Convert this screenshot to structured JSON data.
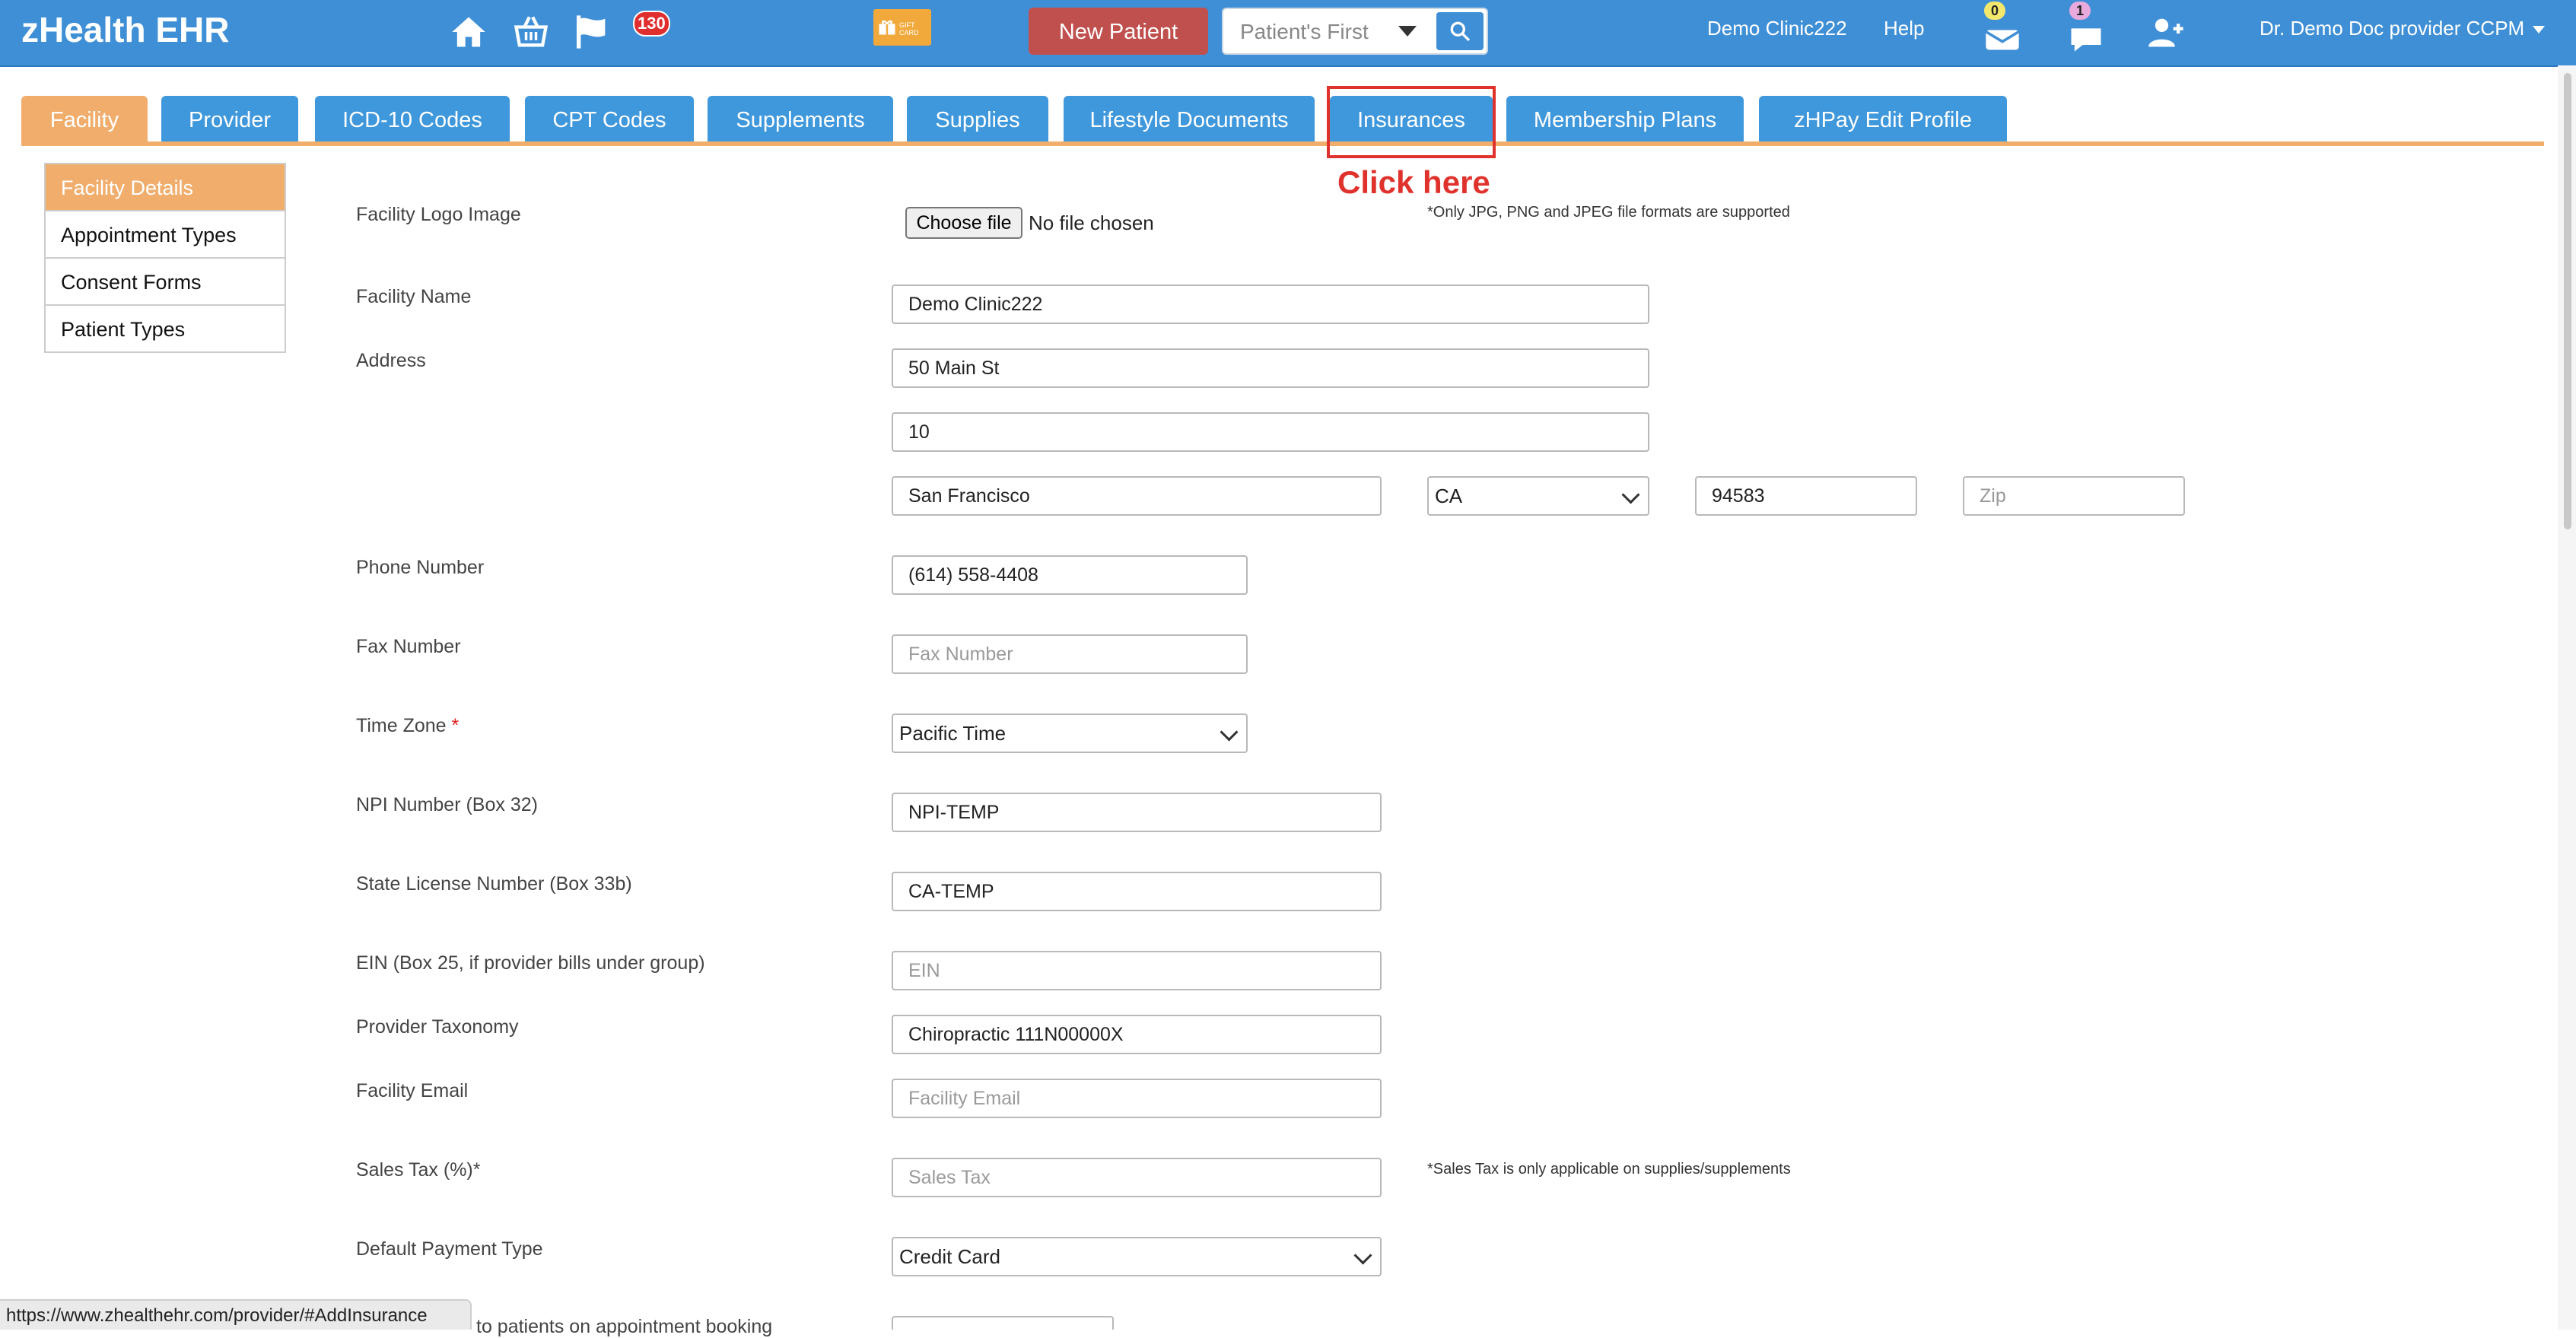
{
  "header": {
    "brand": "zHealth EHR",
    "icons": [
      "home-icon",
      "basket-icon",
      "flag-icon",
      "gift-icon",
      "mail-icon",
      "chat-icon",
      "add-user-icon"
    ],
    "alerts_count": "130",
    "gift_label": "GIFT CARD",
    "new_patient_label": "New Patient",
    "search_placeholder": "Patient's First",
    "clinic_name": "Demo Clinic222",
    "help_label": "Help",
    "mail_count": "0",
    "chat_count": "1",
    "user_name": "Dr. Demo Doc provider CCPM"
  },
  "tabs": [
    "Facility",
    "Provider",
    "ICD-10 Codes",
    "CPT Codes",
    "Supplements",
    "Supplies",
    "Lifestyle Documents",
    "Insurances",
    "Membership Plans",
    "zHPay Edit Profile"
  ],
  "annotation": {
    "label": "Click here",
    "target": "Insurances"
  },
  "sidebar": [
    "Facility Details",
    "Appointment Types",
    "Consent Forms",
    "Patient Types"
  ],
  "form": {
    "logo_label": "Facility Logo Image",
    "choose_file": "Choose file",
    "no_file": "No file chosen",
    "logo_note": "*Only JPG, PNG and JPEG file formats are supported",
    "facility_name_label": "Facility Name",
    "facility_name": "Demo Clinic222",
    "address_label": "Address",
    "address1": "50 Main St",
    "address2": "10",
    "city": "San Francisco",
    "state": "CA",
    "zip_value": "94583",
    "zip_placeholder": "Zip",
    "phone_label": "Phone Number",
    "phone": "(614) 558-4408",
    "fax_label": "Fax Number",
    "fax_placeholder": "Fax Number",
    "timezone_label": "Time Zone",
    "timezone_required": "*",
    "timezone": "Pacific Time",
    "npi_label": "NPI Number (Box 32)",
    "npi": "NPI-TEMP",
    "license_label": "State License Number (Box 33b)",
    "license": "CA-TEMP",
    "ein_label": "EIN (Box 25, if provider bills under group)",
    "ein_placeholder": "EIN",
    "taxonomy_label": "Provider Taxonomy",
    "taxonomy": "Chiropractic 111N00000X",
    "email_label": "Facility Email",
    "email_placeholder": "Facility Email",
    "sales_tax_label": "Sales Tax (%)*",
    "sales_tax_placeholder": "Sales Tax",
    "sales_tax_note": "*Sales Tax is only applicable on supplies/supplements",
    "payment_label": "Default Payment Type",
    "payment": "Credit Card",
    "booking_label": "to patients on appointment booking"
  },
  "status_url": "https://www.zhealthehr.com/provider/#AddInsurance"
}
